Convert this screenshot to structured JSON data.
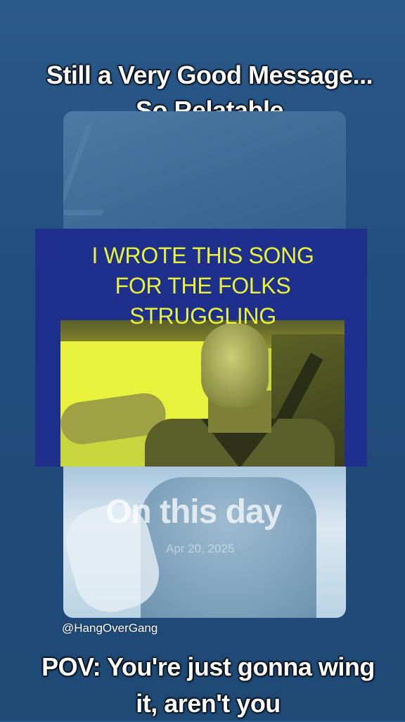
{
  "top_caption": {
    "line1": "Still a Very Good Message...",
    "line2": "So Relatable"
  },
  "video_overlay": {
    "line1": "I WROTE THIS SONG",
    "line2": "FOR THE FOLKS",
    "line3": "STRUGGLING"
  },
  "memory_watermark": {
    "title": "On this day",
    "date": "Apr 20, 2025"
  },
  "author": {
    "handle": "@HangOverGang"
  },
  "bottom_caption": {
    "line1": "POV: You're just gonna wing",
    "line2": "it, aren't you"
  },
  "colors": {
    "background": "#214e7e",
    "overlay_panel": "#1e2f8c",
    "overlay_text": "#e8f23a",
    "caption_text": "#ffffff"
  }
}
